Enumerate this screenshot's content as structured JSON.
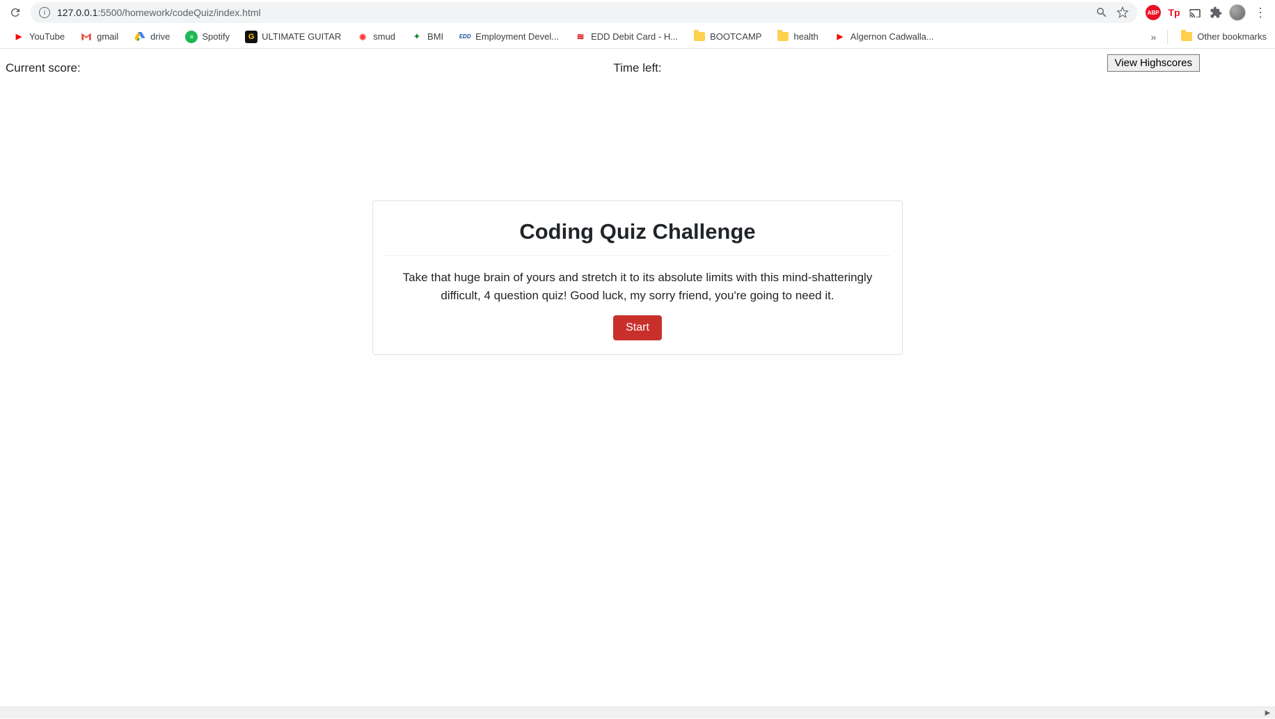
{
  "browser": {
    "url_host": "127.0.0.1",
    "url_port_path": ":5500/homework/codeQuiz/index.html",
    "extensions": {
      "abp": "ABP",
      "tp": "Tp"
    }
  },
  "bookmarks": [
    {
      "label": "YouTube",
      "icon": "youtube"
    },
    {
      "label": "gmail",
      "icon": "gmail"
    },
    {
      "label": "drive",
      "icon": "drive"
    },
    {
      "label": "Spotify",
      "icon": "spotify"
    },
    {
      "label": "ULTIMATE GUITAR",
      "icon": "ug"
    },
    {
      "label": "smud",
      "icon": "smud"
    },
    {
      "label": "BMI",
      "icon": "bmi"
    },
    {
      "label": "Employment Devel...",
      "icon": "edd"
    },
    {
      "label": "EDD Debit Card - H...",
      "icon": "eddcard"
    },
    {
      "label": "BOOTCAMP",
      "icon": "folder"
    },
    {
      "label": "health",
      "icon": "folder"
    },
    {
      "label": "Algernon Cadwalla...",
      "icon": "youtube"
    }
  ],
  "other_bookmarks_label": "Other bookmarks",
  "overflow_symbol": "»",
  "page": {
    "score_label": "Current score:",
    "time_label": "Time left:",
    "highscores_button": "View Highscores",
    "title": "Coding Quiz Challenge",
    "description": "Take that huge brain of yours and stretch it to its absolute limits with this mind-shatteringly difficult, 4 question quiz! Good luck, my sorry friend, you're going to need it.",
    "start_button": "Start"
  }
}
